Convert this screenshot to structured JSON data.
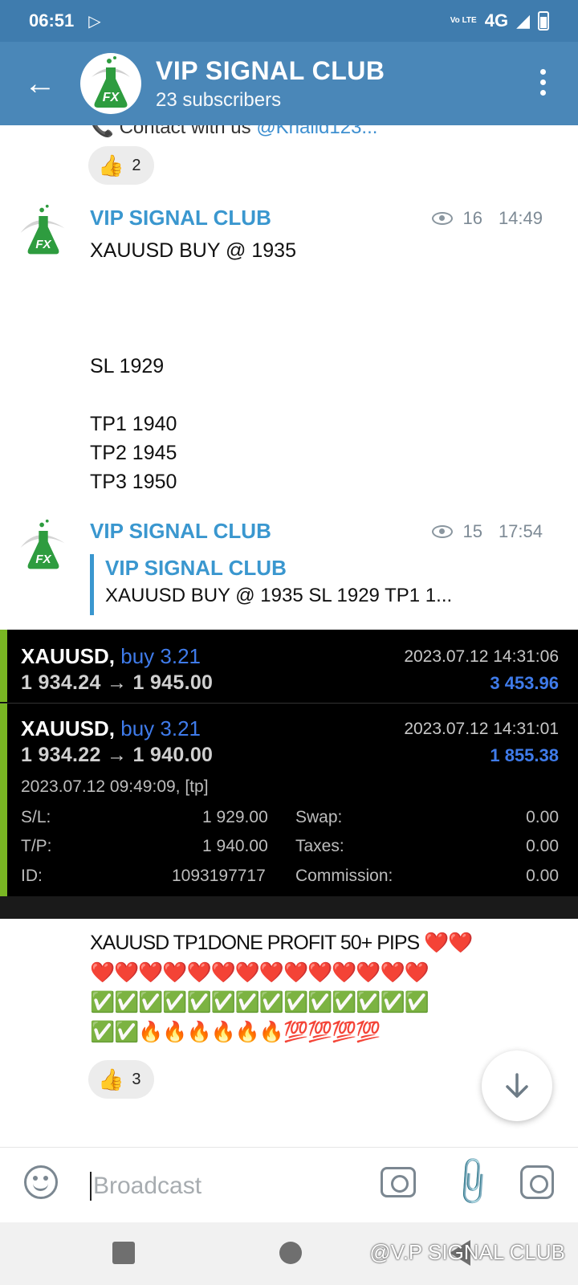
{
  "status": {
    "time": "06:51",
    "network": "4G",
    "volte": "Vo LTE"
  },
  "header": {
    "title": "VIP SIGNAL CLUB",
    "subtitle": "23 subscribers",
    "avatar_text": "FX"
  },
  "chat": {
    "cut_text": "Contact with us ",
    "cut_link": "@Khalid123...",
    "reaction1_count": "2",
    "msg1": {
      "author": "VIP SIGNAL CLUB",
      "views": "16",
      "time": "14:49",
      "text": "XAUUSD BUY @ 1935\n\n\n\nSL 1929\n\nTP1 1940\nTP2 1945\nTP3 1950"
    },
    "msg2": {
      "author": "VIP SIGNAL CLUB",
      "views": "15",
      "time": "17:54",
      "reply_author": "VIP SIGNAL CLUB",
      "reply_text": "XAUUSD BUY @ 1935 SL 1929 TP1 1..."
    },
    "trade": {
      "t1_symbol": "XAUUSD,",
      "t1_side": "buy 3.21",
      "t1_prices": "1 934.24 → 1 945.00",
      "t1_date": "2023.07.12 14:31:06",
      "t1_profit": "3 453.96",
      "t2_symbol": "XAUUSD,",
      "t2_side": "buy 3.21",
      "t2_prices": "1 934.22 → 1 940.00",
      "t2_date": "2023.07.12 14:31:01",
      "t2_profit": "1 855.38",
      "open_time": "2023.07.12 09:49:09, [tp]",
      "sl_label": "S/L:",
      "sl_value": "1 929.00",
      "tp_label": "T/P:",
      "tp_value": "1 940.00",
      "id_label": "ID:",
      "id_value": "1093197717",
      "swap_label": "Swap:",
      "swap_value": "0.00",
      "taxes_label": "Taxes:",
      "taxes_value": "0.00",
      "commission_label": "Commission:",
      "commission_value": "0.00"
    },
    "msg3": {
      "line1": "XAUUSD TP1DONE PROFIT 50+ PIPS ❤️❤️",
      "line2": "❤️❤️❤️❤️❤️❤️❤️❤️❤️❤️❤️❤️❤️❤️",
      "line3": "✅✅✅✅✅✅✅✅✅✅✅✅✅✅",
      "line4": "✅✅🔥🔥🔥🔥🔥🔥💯💯💯💯"
    },
    "reaction2_count": "3"
  },
  "input": {
    "placeholder": "Broadcast"
  },
  "watermark": "@V.P SIGNAL CLUB",
  "icons": {
    "back": "arrow-left-icon",
    "menu": "more-vertical-icon",
    "views": "eye-icon",
    "scroll": "chevron-down-icon",
    "emoji": "smile-icon",
    "camera": "camera-icon",
    "attach": "paperclip-icon",
    "instagram": "instagram-icon"
  },
  "colors": {
    "header_bg": "#4a87b8",
    "status_bg": "#3f7cae",
    "author": "#3a97cf",
    "trade_bg": "#000000",
    "trade_accent": "#79b623",
    "trade_blue": "#3f7bea"
  }
}
